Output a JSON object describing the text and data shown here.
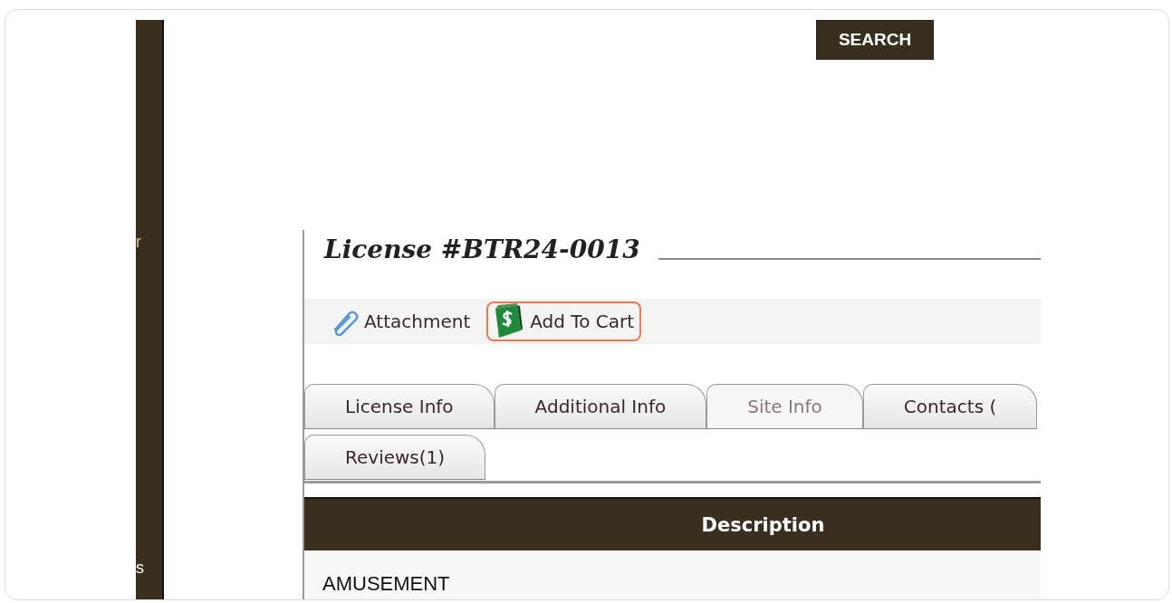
{
  "sidebar": {
    "fragments": [
      "r",
      "s"
    ]
  },
  "search_button": {
    "label": "SEARCH"
  },
  "license": {
    "title": "License #BTR24-0013"
  },
  "toolbar": [
    {
      "label": "Attachment",
      "kind": "attachment",
      "highlighted": false
    },
    {
      "label": "Add To Cart",
      "kind": "cart",
      "highlighted": true
    }
  ],
  "tabs": [
    [
      {
        "label": "License Info",
        "selected": false
      },
      {
        "label": "Additional Info",
        "selected": false
      },
      {
        "label": "Site Info",
        "selected": true
      },
      {
        "label": "Contacts (",
        "selected": false
      }
    ],
    [
      {
        "label": "Reviews(1)",
        "selected": false
      }
    ]
  ],
  "table": {
    "columns": [
      "Description"
    ],
    "rows": [
      [
        "AMUSEMENT"
      ]
    ]
  }
}
